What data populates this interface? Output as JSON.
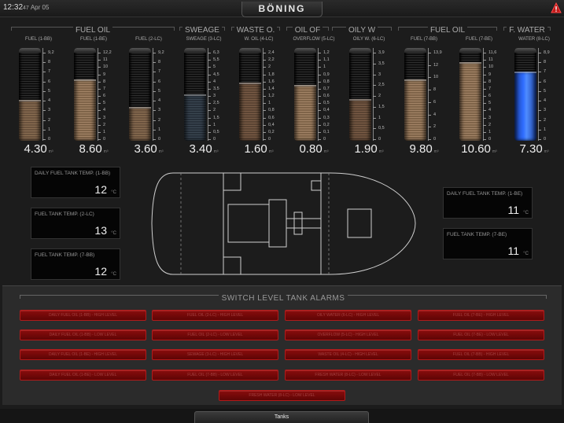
{
  "header": {
    "time": "12:32",
    "seconds": "47",
    "date": "Apr 05",
    "logo": "BÖNING",
    "alarm_icon": "warning-triangle-icon"
  },
  "groups": [
    "FUEL OIL",
    "SWEAGE",
    "WASTE O.",
    "OIL OF",
    "OILY W",
    "FUEL OIL",
    "F. WATER"
  ],
  "tanks": [
    {
      "name": "FUEL (1-BB)",
      "value": "4.30",
      "unit": "m³",
      "level": 0.47,
      "scale": [
        "9,2",
        "8",
        "7",
        "6",
        "5",
        "4",
        "3",
        "2",
        "1",
        "0"
      ]
    },
    {
      "name": "FUEL (1-BE)",
      "value": "8.60",
      "unit": "m³",
      "level": 0.71,
      "scale": [
        "12,2",
        "11",
        "10",
        "9",
        "8",
        "7",
        "6",
        "5",
        "4",
        "3",
        "2",
        "1",
        "0"
      ]
    },
    {
      "name": "FUEL (2-LC)",
      "value": "3.60",
      "unit": "m³",
      "level": 0.39,
      "scale": [
        "9,2",
        "8",
        "7",
        "6",
        "5",
        "4",
        "3",
        "2",
        "1",
        "0"
      ]
    },
    {
      "name": "SWEAGE (3-LC)",
      "value": "3.40",
      "unit": "m³",
      "level": 0.54,
      "scale": [
        "6,3",
        "5,5",
        "5",
        "4,5",
        "4",
        "3,5",
        "3",
        "2,5",
        "2",
        "1,5",
        "1",
        "0,5",
        "0"
      ]
    },
    {
      "name": "W. OIL (4-LC)",
      "value": "1.60",
      "unit": "m³",
      "level": 0.67,
      "scale": [
        "2,4",
        "2,2",
        "2",
        "1,8",
        "1,6",
        "1,4",
        "1,2",
        "1",
        "0,8",
        "0,6",
        "0,4",
        "0,2",
        "0"
      ]
    },
    {
      "name": "OVERFLOW (5-LC)",
      "value": "0.80",
      "unit": "m³",
      "level": 0.65,
      "scale": [
        "1,2",
        "1,1",
        "1",
        "0,9",
        "0,8",
        "0,7",
        "0,6",
        "0,5",
        "0,4",
        "0,3",
        "0,2",
        "0,1",
        "0"
      ]
    },
    {
      "name": "OILY W. (6-LC)",
      "value": "1.90",
      "unit": "m³",
      "level": 0.48,
      "scale": [
        "3,9",
        "3,5",
        "3",
        "2,5",
        "2",
        "1,5",
        "1",
        "0,5",
        "0"
      ]
    },
    {
      "name": "FUEL (7-BB)",
      "value": "9.80",
      "unit": "m³",
      "level": 0.71,
      "scale": [
        "13,9",
        "12",
        "10",
        "8",
        "6",
        "4",
        "2",
        "0"
      ]
    },
    {
      "name": "FUEL (7-BE)",
      "value": "10.60",
      "unit": "m³",
      "level": 0.91,
      "scale": [
        "11,6",
        "11",
        "10",
        "9",
        "8",
        "7",
        "6",
        "5",
        "4",
        "3",
        "2",
        "1",
        "0"
      ]
    },
    {
      "name": "WATER (8-LC)",
      "value": "7.30",
      "unit": "m³",
      "level": 0.8,
      "scale": [
        "8,9",
        "8",
        "7",
        "6",
        "5",
        "4",
        "3",
        "2",
        "1",
        "0"
      ]
    }
  ],
  "temps": [
    {
      "label": "DAILY FUEL TANK TEMP. (1-BB)",
      "value": "12",
      "unit": "°C"
    },
    {
      "label": "FUEL TANK TEMP. (2-LC)",
      "value": "13",
      "unit": "°C"
    },
    {
      "label": "FUEL TANK TEMP. (7-BB)",
      "value": "12",
      "unit": "°C"
    },
    {
      "label": "DAILY FUEL TANK TEMP. (1-BE)",
      "value": "11",
      "unit": "°C"
    },
    {
      "label": "FUEL TANK TEMP. (7-BE)",
      "value": "11",
      "unit": "°C"
    }
  ],
  "alarms": {
    "title": "SWITCH LEVEL TANK ALARMS",
    "items": [
      "DAILY FUEL OIL (1-BB) - HIGH LEVEL",
      "FUEL OIL (2-LC) - HIGH LEVEL",
      "OILY WATER (6-LC) - HIGH LEVEL",
      "FUEL OIL (7-BE) - HIGH LEVEL",
      "DAILY FUEL OIL (1-BB) - LOW LEVEL",
      "FUEL OIL (2-LC) - LOW LEVEL",
      "OVERFLOW (5-LC) - HIGH LEVEL",
      "FUEL OIL (7-BE) - LOW LEVEL",
      "DAILY FUEL OIL (1-BE) - HIGH LEVEL",
      "SEWAGE (3-LC) - HIGH LEVEL",
      "WASTE OIL (4-LC) - HIGH LEVEL",
      "FUEL OIL (7-BB) - HIGH LEVEL",
      "DAILY FUEL OIL (1-BE) - LOW LEVEL",
      "FUEL OIL (7-BB) - LOW LEVEL",
      "FRESH WATER (8-LC) - LOW LEVEL",
      "FUEL OIL (7-BB) - LOW LEVEL",
      "FRESH WATER (8-LC) - LOW LEVEL"
    ]
  },
  "tabs": [
    {
      "label": "Tanks"
    }
  ],
  "colors": {
    "alarm_red": "#8a0d0d",
    "water_blue": "#2f6dff",
    "fuel_brown": "#8a6e52"
  }
}
